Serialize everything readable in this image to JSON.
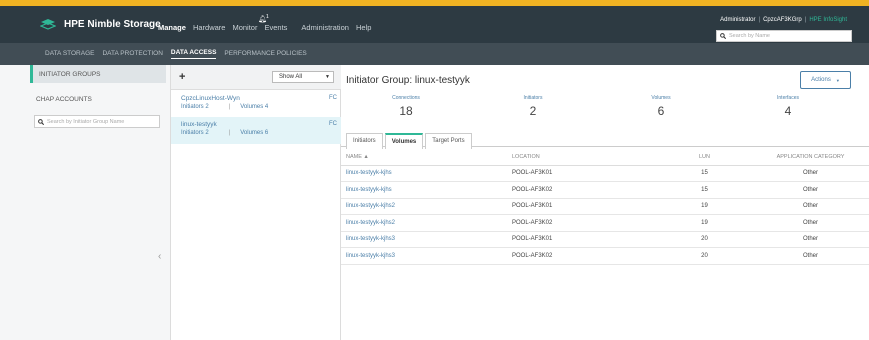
{
  "app": {
    "brand": "HPE Nimble Storage",
    "nav": [
      "Manage",
      "Hardware",
      "Monitor",
      "Events",
      "Administration",
      "Help"
    ],
    "notification_count": "1",
    "user": "Administrator",
    "group": "CpzcAF3KGrp",
    "group_status": "HPE InfoSight",
    "search_placeholder": "Search by Name",
    "accent": "#f0b323"
  },
  "subnav": [
    "DATA STORAGE",
    "DATA PROTECTION",
    "DATA ACCESS",
    "PERFORMANCE POLICIES"
  ],
  "sidebar": {
    "tabs": [
      "INITIATOR GROUPS",
      "CHAP ACCOUNTS"
    ],
    "search_placeholder": "Search by Initiator Group Name"
  },
  "list": {
    "filter": "Show All",
    "items": [
      {
        "name": "CpzcLinuxHost-Wyn",
        "proto": "FC",
        "initiators": "Initiators 2",
        "volumes": "Volumes 4"
      },
      {
        "name": "linux-testyyk",
        "proto": "FC",
        "initiators": "Initiators 2",
        "volumes": "Volumes 6"
      }
    ]
  },
  "detail": {
    "title": "Initiator Group: linux-testyyk",
    "actions_label": "Actions",
    "stats": [
      {
        "label": "Connections",
        "value": "18"
      },
      {
        "label": "Initiators",
        "value": "2"
      },
      {
        "label": "Volumes",
        "value": "6"
      },
      {
        "label": "Interfaces",
        "value": "4"
      }
    ],
    "tabs": [
      "Initiators",
      "Volumes",
      "Target Ports"
    ],
    "columns": [
      "NAME ▲",
      "LOCATION",
      "LUN",
      "APPLICATION CATEGORY"
    ],
    "rows": [
      [
        "linux-testyyk-kjhs",
        "POOL-AF3K01",
        "15",
        "Other"
      ],
      [
        "linux-testyyk-kjhs",
        "POOL-AF3K02",
        "15",
        "Other"
      ],
      [
        "linux-testyyk-kjhs2",
        "POOL-AF3K01",
        "19",
        "Other"
      ],
      [
        "linux-testyyk-kjhs2",
        "POOL-AF3K02",
        "19",
        "Other"
      ],
      [
        "linux-testyyk-kjhs3",
        "POOL-AF3K01",
        "20",
        "Other"
      ],
      [
        "linux-testyyk-kjhs3",
        "POOL-AF3K02",
        "20",
        "Other"
      ]
    ]
  }
}
